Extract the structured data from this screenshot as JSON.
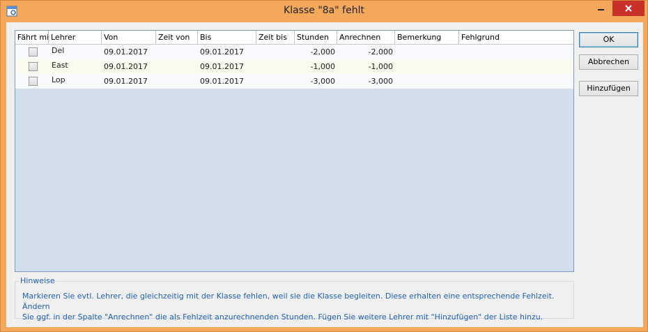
{
  "window": {
    "title": "Klasse \"8a\" fehlt",
    "colors": {
      "frame": "#f3a85b",
      "close": "#c7312a",
      "grid_bg": "#d3deec",
      "hint_text": "#1e5fb4"
    }
  },
  "table": {
    "columns": [
      "Fährt mit",
      "Lehrer",
      "Von",
      "Zeit von",
      "Bis",
      "Zeit bis",
      "Stunden",
      "Anrechnen",
      "Bemerkung",
      "Fehlgrund"
    ],
    "rows": [
      {
        "faehrt_mit": false,
        "lehrer": "Del",
        "von": "09.01.2017",
        "zeit_von": "",
        "bis": "09.01.2017",
        "zeit_bis": "",
        "stunden": "-2,000",
        "anrechnen": "-2,000",
        "bemerkung": "",
        "fehlgrund": ""
      },
      {
        "faehrt_mit": false,
        "lehrer": "East",
        "von": "09.01.2017",
        "zeit_von": "",
        "bis": "09.01.2017",
        "zeit_bis": "",
        "stunden": "-1,000",
        "anrechnen": "-1,000",
        "bemerkung": "",
        "fehlgrund": ""
      },
      {
        "faehrt_mit": false,
        "lehrer": "Lop",
        "von": "09.01.2017",
        "zeit_von": "",
        "bis": "09.01.2017",
        "zeit_bis": "",
        "stunden": "-3,000",
        "anrechnen": "-3,000",
        "bemerkung": "",
        "fehlgrund": ""
      }
    ]
  },
  "buttons": {
    "ok": "OK",
    "cancel": "Abbrechen",
    "add": "Hinzufügen"
  },
  "hints": {
    "legend": "Hinweise",
    "line1": "Markieren Sie evtl. Lehrer, die gleichzeitig mit der Klasse fehlen, weil sie die Klasse begleiten. Diese erhalten eine entsprechende Fehlzeit. Ändern",
    "line2": "Sie ggf. in der Spalte \"Anrechnen\" die als Fehlzeit anzurechnenden Stunden. Fügen Sie weitere Lehrer mit \"Hinzufügen\" der Liste hinzu."
  },
  "icons": {
    "app": "app-window-icon",
    "minimize": "minimize-icon",
    "maximize": "maximize-icon",
    "close": "close-icon"
  }
}
